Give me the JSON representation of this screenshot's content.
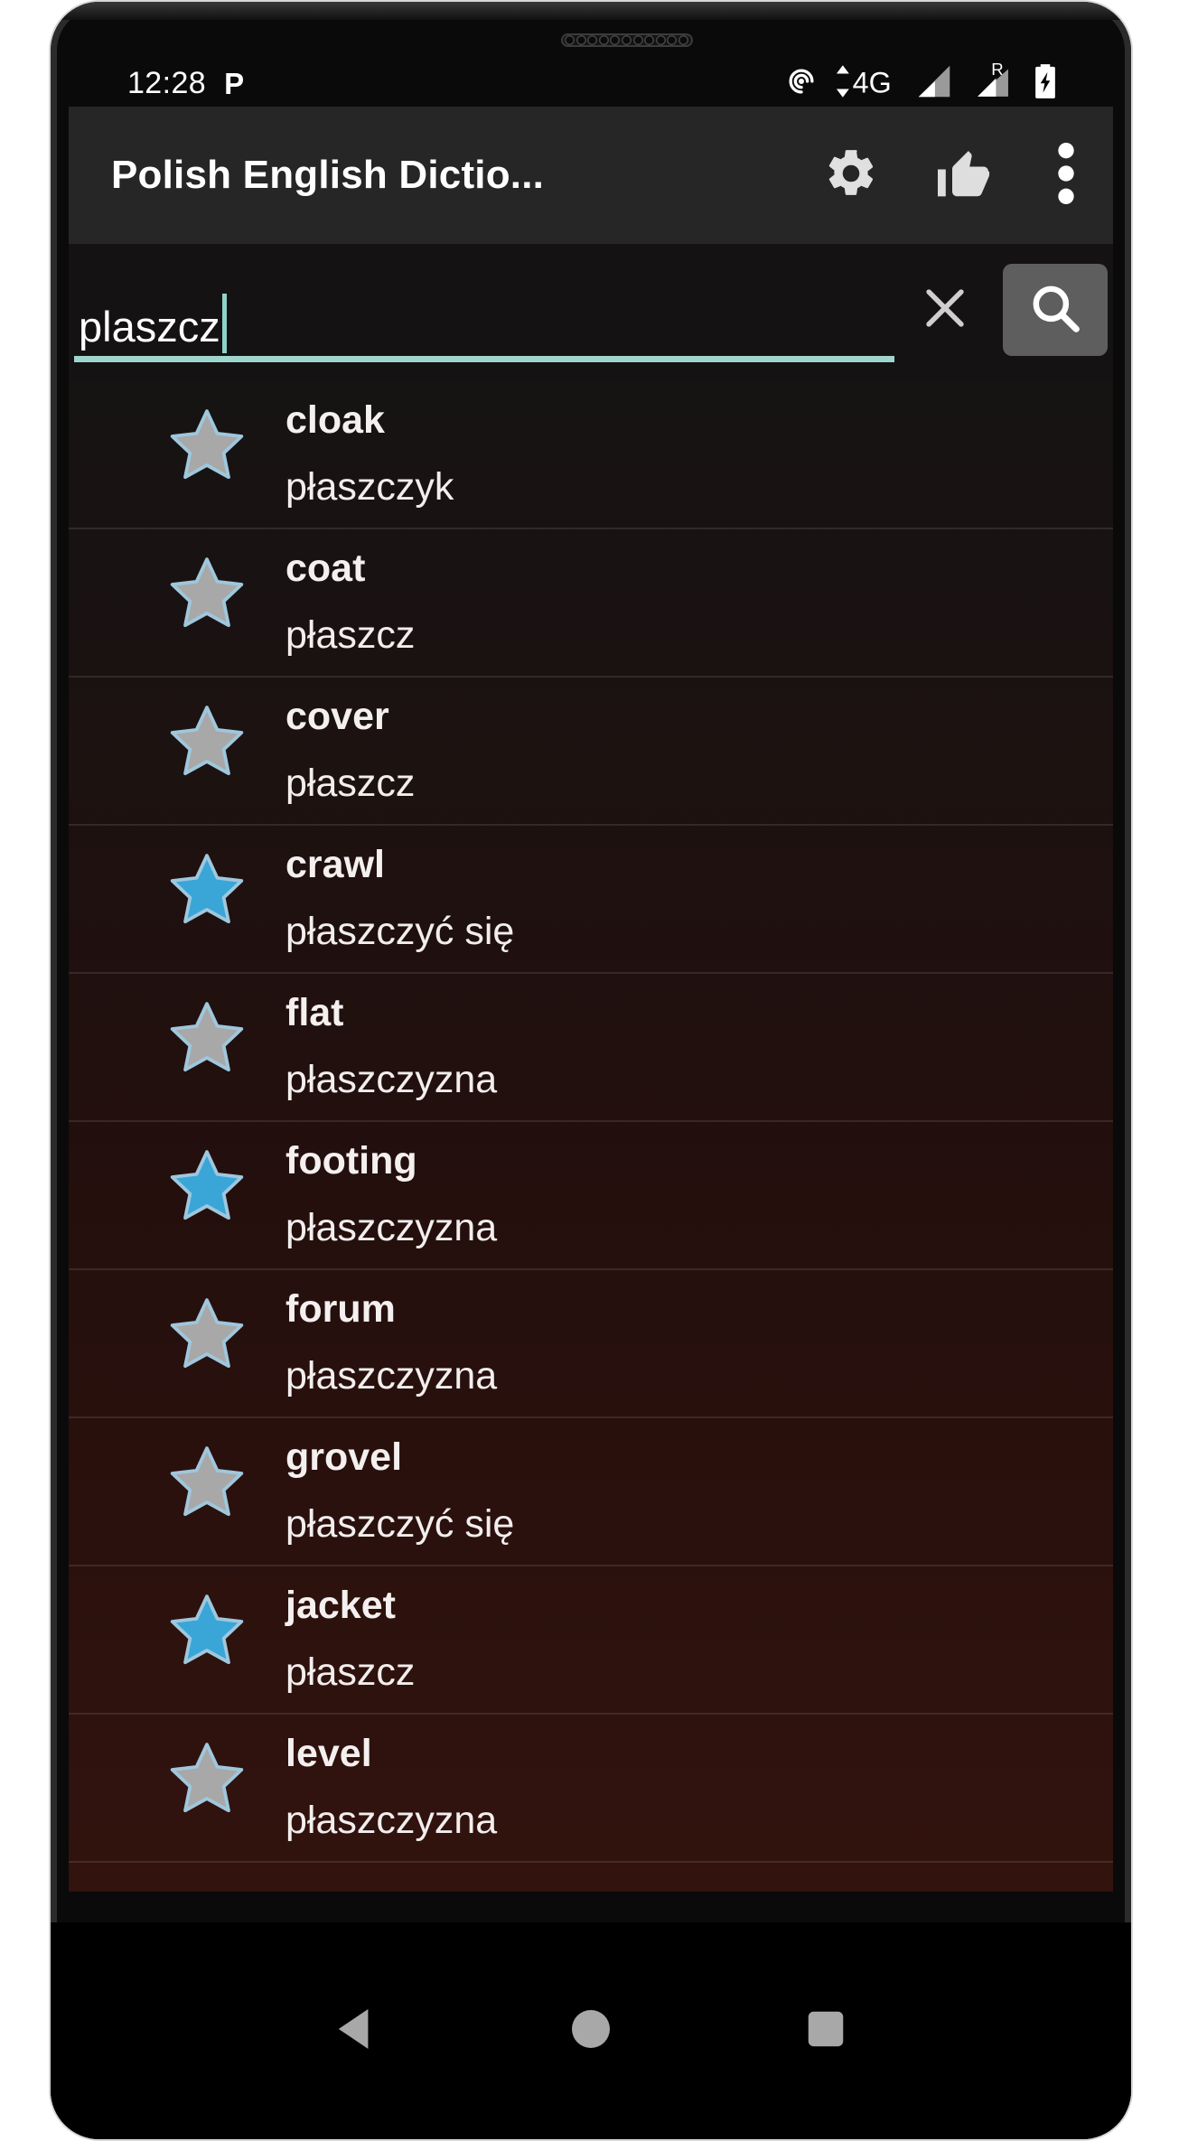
{
  "status_bar": {
    "time": "12:28",
    "app_indicator": "P",
    "icons": [
      "hotspot-icon",
      "data-transfer-4g-icon",
      "signal-bars-icon",
      "roaming-signal-icon",
      "battery-charging-icon"
    ],
    "network_label": "4G",
    "roaming_label": "R"
  },
  "app_bar": {
    "title": "Polish English Dictio...",
    "actions": [
      {
        "name": "settings",
        "icon": "gear-icon"
      },
      {
        "name": "rate",
        "icon": "thumbs-up-icon"
      },
      {
        "name": "overflow",
        "icon": "more-vertical-icon"
      }
    ]
  },
  "search": {
    "value": "plaszcz",
    "placeholder": "",
    "clear_icon": "close-icon",
    "search_icon": "search-icon",
    "accent_color": "#9ed6cd"
  },
  "results": {
    "star_on_color": "#3aa6d8",
    "star_off_color": "#a8a8a8",
    "items": [
      {
        "term": "cloak",
        "translation": "płaszczyk",
        "starred": false
      },
      {
        "term": "coat",
        "translation": "płaszcz",
        "starred": false
      },
      {
        "term": "cover",
        "translation": "płaszcz",
        "starred": false
      },
      {
        "term": "crawl",
        "translation": "płaszczyć się",
        "starred": true
      },
      {
        "term": "flat",
        "translation": "płaszczyzna",
        "starred": false
      },
      {
        "term": "footing",
        "translation": "płaszczyzna",
        "starred": true
      },
      {
        "term": "forum",
        "translation": "płaszczyzna",
        "starred": false
      },
      {
        "term": "grovel",
        "translation": "płaszczyć się",
        "starred": false
      },
      {
        "term": "jacket",
        "translation": "płaszcz",
        "starred": true
      },
      {
        "term": "level",
        "translation": "płaszczyzna",
        "starred": false
      }
    ]
  },
  "nav_bar": {
    "buttons": [
      {
        "name": "back",
        "icon": "triangle-back-icon"
      },
      {
        "name": "home",
        "icon": "circle-home-icon"
      },
      {
        "name": "recents",
        "icon": "square-recents-icon"
      }
    ]
  }
}
